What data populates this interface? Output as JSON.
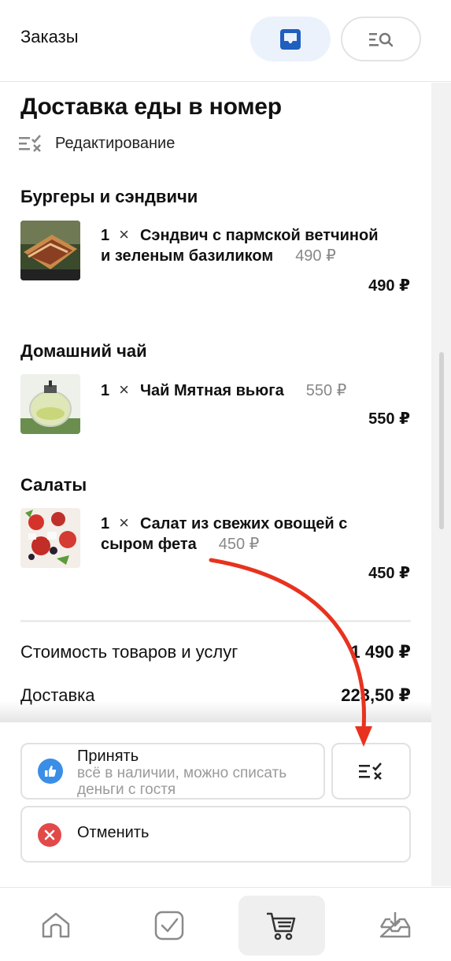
{
  "header": {
    "title": "Заказы",
    "inbox_icon": "inbox-icon",
    "search_icon": "filter-search-icon"
  },
  "order": {
    "title": "Доставка еды в номер",
    "edit_label": "Редактирование",
    "sections": [
      {
        "title": "Бургеры и сэндвичи",
        "item": {
          "qty": "1",
          "times": "×",
          "name_line1": "Сэндвич с пармской ветчиной",
          "name_line2": "и зеленым базиликом",
          "unit_price": "490 ₽",
          "total": "490 ₽"
        }
      },
      {
        "title": "Домашний чай",
        "item": {
          "qty": "1",
          "times": "×",
          "name_line1": "Чай Мятная вьюга",
          "unit_price": "550 ₽",
          "total": "550 ₽"
        }
      },
      {
        "title": "Салаты",
        "item": {
          "qty": "1",
          "times": "×",
          "name_line1": "Салат из свежих овощей с",
          "name_line2": "сыром фета",
          "unit_price": "450 ₽",
          "total": "450 ₽"
        }
      }
    ],
    "summary": {
      "goods_label": "Стоимость товаров и услуг",
      "goods_value": "1 490 ₽",
      "delivery_label": "Доставка",
      "delivery_value": "223,50 ₽"
    }
  },
  "actions": {
    "accept_label": "Принять",
    "accept_sub": "всё в наличии, можно списать деньги с гостя",
    "cancel_label": "Отменить",
    "edit_icon": "edit-list-icon"
  },
  "nav": {
    "items": [
      "home-icon",
      "check-icon",
      "cart-icon",
      "inbox-download-icon"
    ],
    "active": "cart-icon"
  },
  "colors": {
    "accent_blue": "#3a8ee6",
    "cancel_red": "#e24a4a",
    "annotation_arrow": "#e8321e",
    "header_active_bg": "#ecf2fc"
  }
}
